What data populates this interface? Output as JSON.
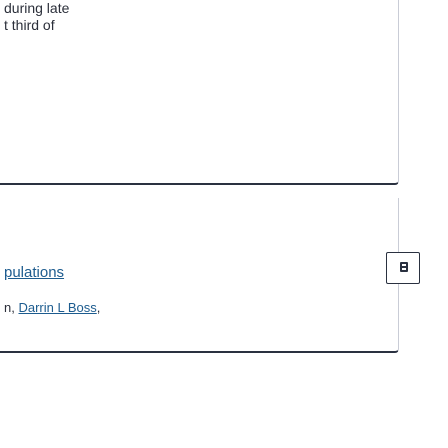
{
  "results": [
    {
      "snippet_lines": [
        "during late",
        "t third of"
      ]
    },
    {
      "title": "pulations",
      "authors_prefix": "n, ",
      "author_link": "Darrin L Boss",
      "authors_suffix": ","
    }
  ],
  "icons": {
    "pdf_button_icon": "document-icon"
  },
  "colors": {
    "link": "#1d5c8f",
    "text": "#2b2f3a",
    "border": "#2a3140"
  }
}
